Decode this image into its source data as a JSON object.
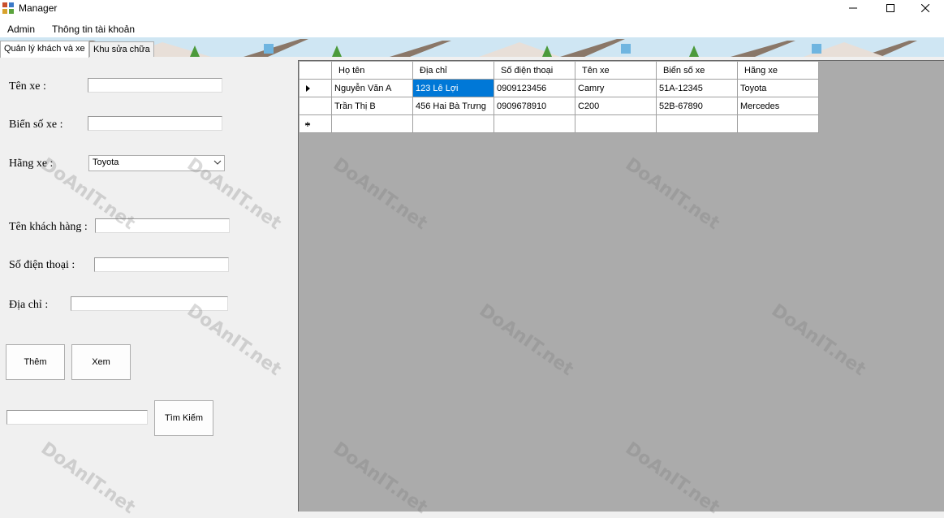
{
  "window": {
    "title": "Manager"
  },
  "menu": {
    "items": [
      "Admin",
      "Thông tin tài khoản"
    ]
  },
  "tabs": [
    "Quản lý khách và xe",
    "Khu sửa chữa"
  ],
  "form": {
    "car_name_label": "Tên xe :",
    "plate_label": "Biển số xe :",
    "brand_label": "Hãng xe :",
    "brand_selected": "Toyota",
    "customer_label": "Tên khách hàng :",
    "phone_label": "Số điện thoại :",
    "address_label": "Địa chỉ :"
  },
  "buttons": {
    "add": "Thêm",
    "view": "Xem",
    "search": "Tìm Kiếm"
  },
  "grid": {
    "columns": [
      "Họ tên",
      "Địa chỉ",
      "Số điện thoại",
      "Tên xe",
      "Biển số xe",
      "Hãng xe"
    ],
    "rows": [
      [
        "Nguyễn Văn A",
        "123 Lê Lợi",
        "0909123456",
        "Camry",
        "51A-12345",
        "Toyota"
      ],
      [
        "Trần Thị B",
        "456 Hai Bà Trưng",
        "0909678910",
        "C200",
        "52B-67890",
        "Mercedes"
      ]
    ],
    "selected_cell": "123 Lê Lợi"
  },
  "watermark": "DoAnIT.net",
  "colors": {
    "selection": "#0078d7",
    "grid_background": "#ababab",
    "window": "#f0f0f0"
  }
}
